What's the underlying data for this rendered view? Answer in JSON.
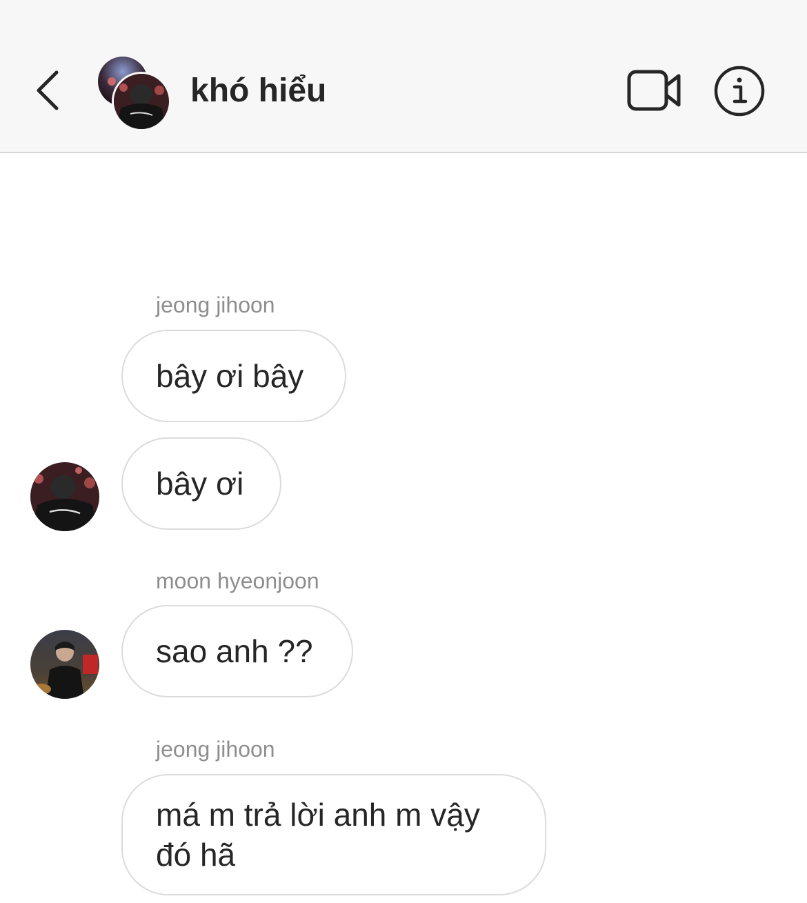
{
  "header": {
    "title": "khó hiểu",
    "back_icon": "chevron-left-icon",
    "video_icon": "video-camera-icon",
    "info_icon": "info-icon"
  },
  "messages": [
    {
      "sender": "jeong jihoon",
      "text": "bây ơi bây"
    },
    {
      "sender": "",
      "text": "bây ơi"
    },
    {
      "sender": "moon hyeonjoon",
      "text": "sao anh ??"
    },
    {
      "sender": "jeong jihoon",
      "text_line1": "má m trả lời anh m vậy",
      "text_line2": "đó hã"
    }
  ],
  "colors": {
    "header_bg": "#f7f7f7",
    "bubble_border": "#dbdbdb",
    "sender_text": "#8e8e8e",
    "text": "#262626"
  }
}
